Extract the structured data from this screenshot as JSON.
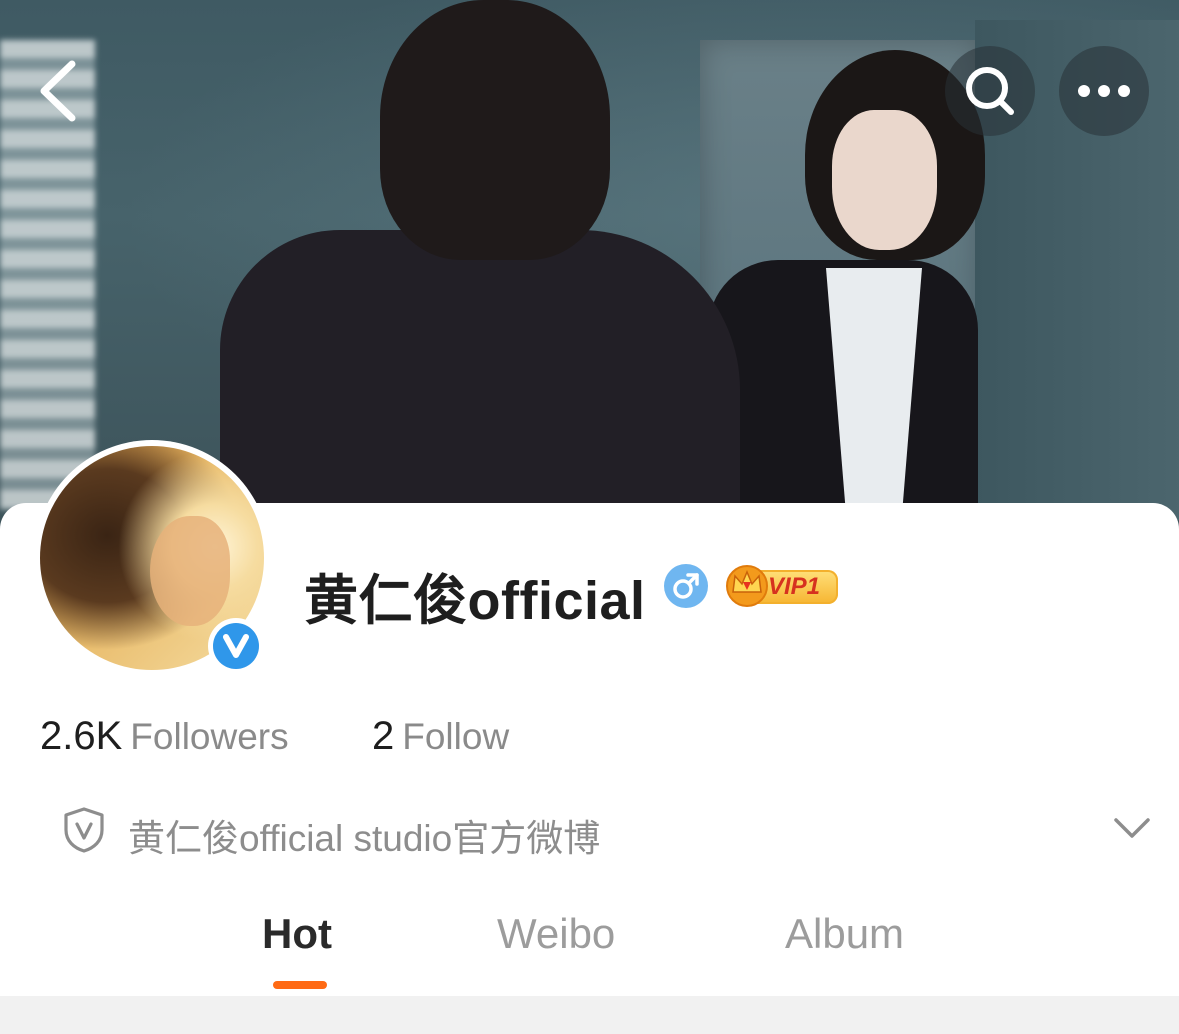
{
  "header": {
    "back_icon": "chevron-left-icon",
    "search_icon": "search-icon",
    "more_icon": "more-horizontal-icon"
  },
  "profile": {
    "name": "黄仁俊official",
    "gender_icon": "male-icon",
    "gender_symbol": "♂",
    "vip_label": "VIP1",
    "verified_icon": "verified-v-icon",
    "verified_letter": "v"
  },
  "stats": {
    "followers_count": "2.6K",
    "followers_label": "Followers",
    "follow_count": "2",
    "follow_label": "Follow"
  },
  "verification": {
    "icon": "shield-v-icon",
    "text": "黄仁俊official studio官方微博",
    "expand_icon": "chevron-down-icon"
  },
  "tabs": [
    {
      "label": "Hot",
      "active": true
    },
    {
      "label": "Weibo",
      "active": false
    },
    {
      "label": "Album",
      "active": false
    }
  ],
  "colors": {
    "accent": "#ff6a14",
    "verified_blue": "#2f97ea",
    "gender_blue": "#6fb6f0",
    "vip_red": "#d6311f",
    "vip_gold": "#f6b531"
  }
}
